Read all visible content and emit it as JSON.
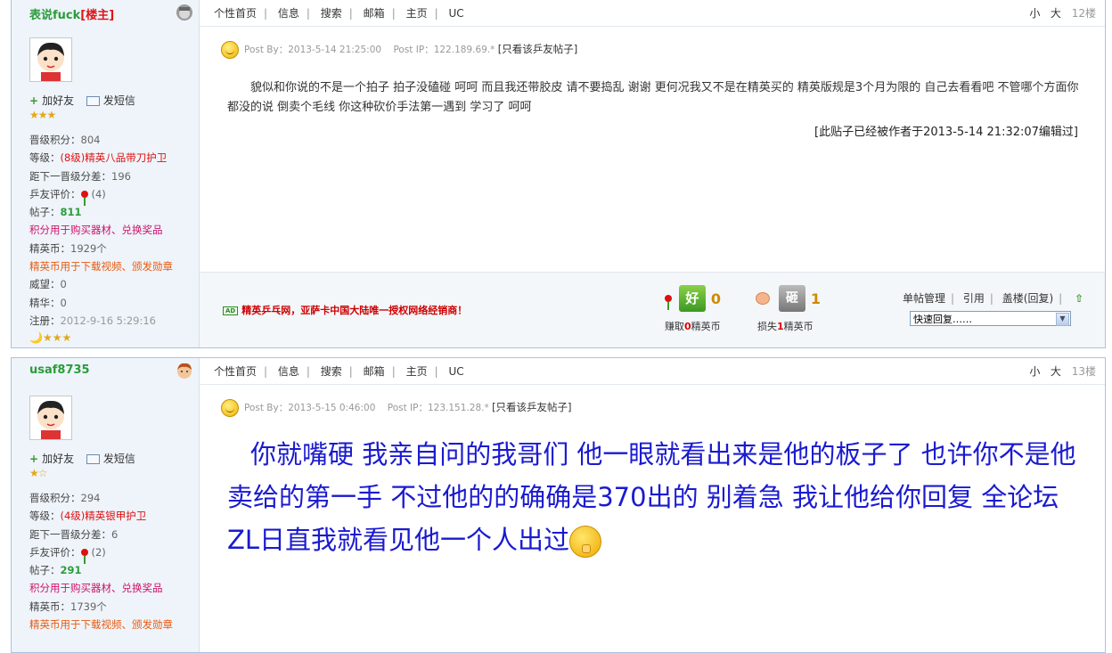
{
  "posts": [
    {
      "username": "表说fuck",
      "op_tag": "[楼主]",
      "add_friend": "加好友",
      "send_message": "发短信",
      "stars": "★★★",
      "stats": {
        "points_label": "晋级积分：",
        "points": "804",
        "level_label": "等级：",
        "level": "(8级)精英八品带刀护卫",
        "next_label": "距下一晋级分差：",
        "next": "196",
        "rating_label": "乒友评价：",
        "rating": "(4)",
        "posts_label": "帖子：",
        "posts": "811",
        "points_note": "积分用于购买器材、兑换奖品",
        "coins_label": "精英币：",
        "coins": "1929个",
        "coins_note": "精英币用于下载视频、颁发勋章",
        "prestige_label": "威望：",
        "prestige": "0",
        "essence_label": "精华：",
        "essence": "0",
        "register_label": "注册：",
        "register": "2012-9-16 5:29:16"
      },
      "medals": "🌙★★★",
      "nav": [
        "个性首页",
        "信息",
        "搜索",
        "邮箱",
        "主页",
        "UC"
      ],
      "font_small": "小",
      "font_large": "大",
      "floor": "12楼",
      "post_by_label": "Post By：",
      "post_time": "2013-5-14 21:25:00",
      "post_ip_label": "Post IP：",
      "post_ip": "122.189.69.*",
      "view_only": "[只看该乒友帖子]",
      "content": "貌似和你说的不是一个拍子  拍子没磕碰  呵呵  而且我还带胶皮  请不要捣乱  谢谢     更何况我又不是在精英买的        精英版规是3个月为限的   自己去看看吧    不管哪个方面你都没的说    倒卖个毛线  你这种砍价手法第一遇到  学习了  呵呵",
      "edited_note": "[此贴子已经被作者于2013-5-14 21:32:07编辑过]",
      "ad_text": "精英乒乓网，亚萨卡中国大陆唯一授权网络经销商！",
      "good_label": "好",
      "good_count": "0",
      "earn_prefix": "赚取",
      "earn_amount": "0",
      "earn_suffix": "精英币",
      "bad_label": "砸",
      "bad_count": "1",
      "lose_prefix": "损失",
      "lose_amount": "1",
      "lose_suffix": "精英币",
      "admin": [
        "单帖管理",
        "引用",
        "盖楼(回复)"
      ],
      "quick_reply": "快速回复……"
    },
    {
      "username": "usaf8735",
      "add_friend": "加好友",
      "send_message": "发短信",
      "stars": "★☆",
      "stats": {
        "points_label": "晋级积分：",
        "points": "294",
        "level_label": "等级：",
        "level": "(4级)精英银甲护卫",
        "next_label": "距下一晋级分差：",
        "next": "6",
        "rating_label": "乒友评价：",
        "rating": "(2)",
        "posts_label": "帖子：",
        "posts": "291",
        "points_note": "积分用于购买器材、兑换奖品",
        "coins_label": "精英币：",
        "coins": "1739个",
        "coins_note": "精英币用于下载视频、颁发勋章"
      },
      "nav": [
        "个性首页",
        "信息",
        "搜索",
        "邮箱",
        "主页",
        "UC"
      ],
      "font_small": "小",
      "font_large": "大",
      "floor": "13楼",
      "post_by_label": "Post By：",
      "post_time": "2013-5-15 0:46:00",
      "post_ip_label": "Post IP：",
      "post_ip": "123.151.28.*",
      "view_only": "[只看该乒友帖子]",
      "content": "你就嘴硬  我亲自问的我哥们  他一眼就看出来是他的板子了  也许你不是他卖给的第一手  不过他的的确确是370出的  别着急  我让他给你回复  全论坛ZL日直我就看见他一个人出过"
    }
  ]
}
